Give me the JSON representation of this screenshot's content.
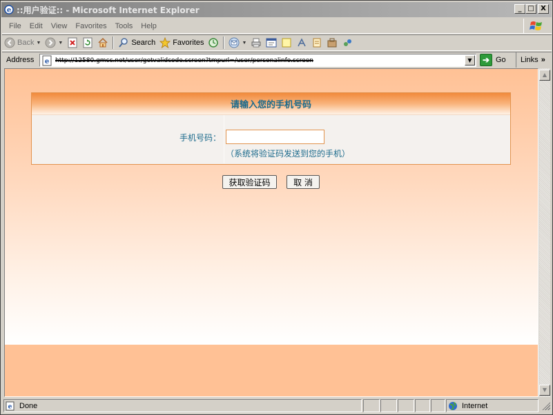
{
  "window": {
    "title": "::用户验证:: - Microsoft Internet Explorer",
    "controls": {
      "minimize": "_",
      "maximize": "□",
      "close": "X"
    }
  },
  "menu": {
    "items": [
      "File",
      "Edit",
      "View",
      "Favorites",
      "Tools",
      "Help"
    ]
  },
  "toolbar": {
    "back_label": "Back",
    "search_label": "Search",
    "favorites_label": "Favorites"
  },
  "address": {
    "label": "Address",
    "url": "http://12580.gmcc.net/user/getvalidcode.screen?tmpurl=/user/personalinfo.screen",
    "go_label": "Go",
    "links_label": "Links"
  },
  "page": {
    "panel_title": "请输入您的手机号码",
    "phone_label": "手机号码：",
    "phone_value": "",
    "hint": "（系统将验证码发送到您的手机）",
    "get_code_button": "获取验证码",
    "cancel_button": "取 消"
  },
  "status": {
    "text": "Done",
    "zone": "Internet"
  },
  "colors": {
    "accent_orange": "#f18a3c",
    "text_blue": "#1b6a8c",
    "page_bg": "#ffc195"
  }
}
